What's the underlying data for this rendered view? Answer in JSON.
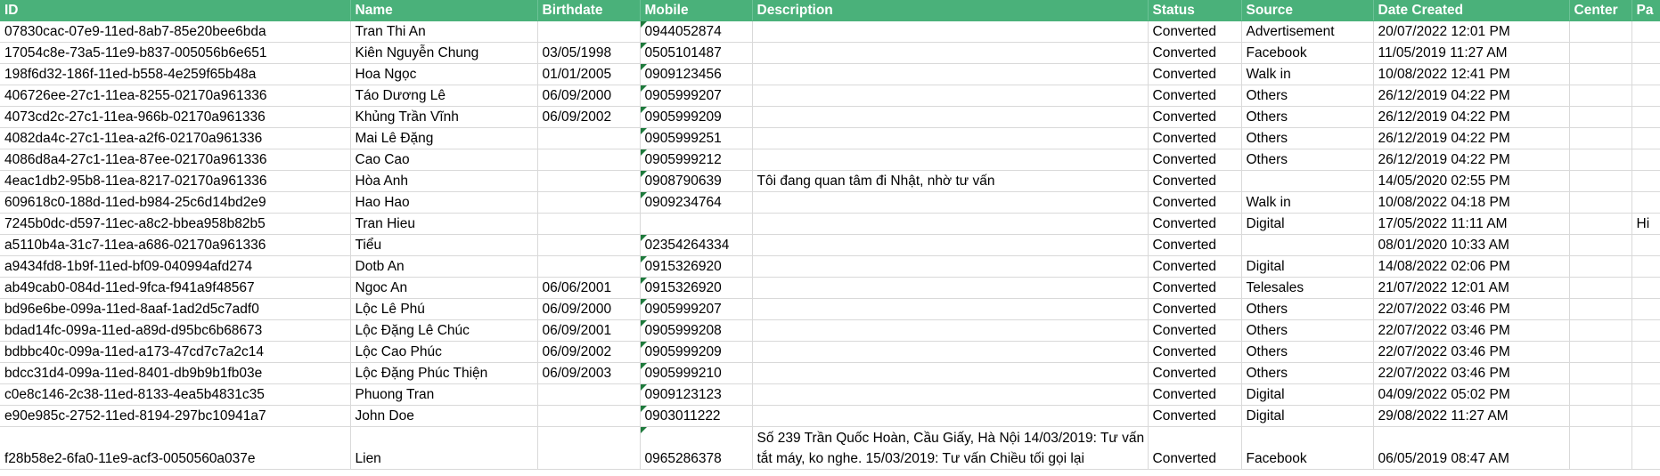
{
  "columns": [
    "ID",
    "Name",
    "Birthdate",
    "Mobile",
    "Description",
    "Status",
    "Source",
    "Date Created",
    "Center",
    "Pa"
  ],
  "rows": [
    {
      "id": "07830cac-07e9-11ed-8ab7-85e20bee6bda",
      "name": "Tran Thi An",
      "birthdate": "",
      "mobile": "0944052874",
      "description": "",
      "status": "Converted",
      "source": "Advertisement",
      "date_created": "20/07/2022 12:01  PM",
      "center": "",
      "pa": ""
    },
    {
      "id": "17054c8e-73a5-11e9-b837-005056b6e651",
      "name": "Kiên Nguyễn Chung",
      "birthdate": "03/05/1998",
      "mobile": "0505101487",
      "description": "",
      "status": "Converted",
      "source": "Facebook",
      "date_created": "11/05/2019 11:27  AM",
      "center": "",
      "pa": ""
    },
    {
      "id": "198f6d32-186f-11ed-b558-4e259f65b48a",
      "name": "Hoa Ngọc",
      "birthdate": "01/01/2005",
      "mobile": "0909123456",
      "description": "",
      "status": "Converted",
      "source": "Walk in",
      "date_created": "10/08/2022 12:41  PM",
      "center": "",
      "pa": ""
    },
    {
      "id": "406726ee-27c1-11ea-8255-02170a961336",
      "name": "Táo Dương Lê",
      "birthdate": "06/09/2000",
      "mobile": "0905999207",
      "description": "",
      "status": "Converted",
      "source": "Others",
      "date_created": "26/12/2019 04:22  PM",
      "center": "",
      "pa": ""
    },
    {
      "id": "4073cd2c-27c1-11ea-966b-02170a961336",
      "name": "Khủng Trần Vĩnh",
      "birthdate": "06/09/2002",
      "mobile": "0905999209",
      "description": "",
      "status": "Converted",
      "source": "Others",
      "date_created": "26/12/2019 04:22  PM",
      "center": "",
      "pa": ""
    },
    {
      "id": "4082da4c-27c1-11ea-a2f6-02170a961336",
      "name": "Mai Lê Đặng",
      "birthdate": "",
      "mobile": "0905999251",
      "description": "",
      "status": "Converted",
      "source": "Others",
      "date_created": "26/12/2019 04:22  PM",
      "center": "",
      "pa": ""
    },
    {
      "id": "4086d8a4-27c1-11ea-87ee-02170a961336",
      "name": "Cao Cao",
      "birthdate": "",
      "mobile": "0905999212",
      "description": "",
      "status": "Converted",
      "source": "Others",
      "date_created": "26/12/2019 04:22  PM",
      "center": "",
      "pa": ""
    },
    {
      "id": "4eac1db2-95b8-11ea-8217-02170a961336",
      "name": "Hòa Anh",
      "birthdate": "",
      "mobile": "0908790639",
      "description": "Tôi đang quan tâm đi Nhật, nhờ tư vấn",
      "status": "Converted",
      "source": "",
      "date_created": "14/05/2020 02:55  PM",
      "center": "",
      "pa": ""
    },
    {
      "id": "609618c0-188d-11ed-b984-25c6d14bd2e9",
      "name": "Hao Hao",
      "birthdate": "",
      "mobile": "0909234764",
      "description": "",
      "status": "Converted",
      "source": "Walk in",
      "date_created": "10/08/2022 04:18  PM",
      "center": "",
      "pa": ""
    },
    {
      "id": "7245b0dc-d597-11ec-a8c2-bbea958b82b5",
      "name": "Tran Hieu",
      "birthdate": "",
      "mobile": "",
      "description": "",
      "status": "Converted",
      "source": "Digital",
      "date_created": "17/05/2022 11:11  AM",
      "center": "",
      "pa": "Hi"
    },
    {
      "id": "a5110b4a-31c7-11ea-a686-02170a961336",
      "name": "Tiểu",
      "birthdate": "",
      "mobile": "02354264334",
      "description": "",
      "status": "Converted",
      "source": "",
      "date_created": "08/01/2020 10:33  AM",
      "center": "",
      "pa": ""
    },
    {
      "id": "a9434fd8-1b9f-11ed-bf09-040994afd274",
      "name": "Dotb An",
      "birthdate": "",
      "mobile": "0915326920",
      "description": "",
      "status": "Converted",
      "source": "Digital",
      "date_created": "14/08/2022 02:06  PM",
      "center": "",
      "pa": ""
    },
    {
      "id": "ab49cab0-084d-11ed-9fca-f941a9f48567",
      "name": "Ngoc An",
      "birthdate": "06/06/2001",
      "mobile": "0915326920",
      "description": "",
      "status": "Converted",
      "source": "Telesales",
      "date_created": "21/07/2022 12:01  AM",
      "center": "",
      "pa": ""
    },
    {
      "id": "bd96e6be-099a-11ed-8aaf-1ad2d5c7adf0",
      "name": "Lộc Lê Phú",
      "birthdate": "06/09/2000",
      "mobile": "0905999207",
      "description": "",
      "status": "Converted",
      "source": "Others",
      "date_created": "22/07/2022 03:46  PM",
      "center": "",
      "pa": ""
    },
    {
      "id": "bdad14fc-099a-11ed-a89d-d95bc6b68673",
      "name": "Lộc Đặng Lê Chúc",
      "birthdate": "06/09/2001",
      "mobile": "0905999208",
      "description": "",
      "status": "Converted",
      "source": "Others",
      "date_created": "22/07/2022 03:46  PM",
      "center": "",
      "pa": ""
    },
    {
      "id": "bdbbc40c-099a-11ed-a173-47cd7c7a2c14",
      "name": "Lộc Cao Phúc",
      "birthdate": "06/09/2002",
      "mobile": "0905999209",
      "description": "",
      "status": "Converted",
      "source": "Others",
      "date_created": "22/07/2022 03:46  PM",
      "center": "",
      "pa": ""
    },
    {
      "id": "bdcc31d4-099a-11ed-8401-db9b9b1fb03e",
      "name": "Lộc Đặng Phúc Thiện",
      "birthdate": "06/09/2003",
      "mobile": "0905999210",
      "description": "",
      "status": "Converted",
      "source": "Others",
      "date_created": "22/07/2022 03:46  PM",
      "center": "",
      "pa": ""
    },
    {
      "id": "c0e8c146-2c38-11ed-8133-4ea5b4831c35",
      "name": "Phuong Tran",
      "birthdate": "",
      "mobile": "0909123123",
      "description": "",
      "status": "Converted",
      "source": "Digital",
      "date_created": "04/09/2022 05:02  PM",
      "center": "",
      "pa": ""
    },
    {
      "id": "e90e985c-2752-11ed-8194-297bc10941a7",
      "name": "John Doe",
      "birthdate": "",
      "mobile": "0903011222",
      "description": "",
      "status": "Converted",
      "source": "Digital",
      "date_created": "29/08/2022 11:27  AM",
      "center": "",
      "pa": ""
    },
    {
      "id": "f28b58e2-6fa0-11e9-acf3-0050560a037e",
      "name": "Lien",
      "birthdate": "",
      "mobile": "0965286378",
      "description": "Số 239 Trần Quốc Hoàn, Cầu Giấy, Hà Nội 14/03/2019: Tư vấn tắt máy, ko nghe. 15/03/2019: Tư vấn Chiều tối gọi lại",
      "status": "Converted",
      "source": "Facebook",
      "date_created": "06/05/2019 08:47  AM",
      "center": "",
      "pa": ""
    }
  ],
  "colors": {
    "header_bg": "#4ab17a",
    "header_text": "#ffffff",
    "gridline": "#d9d9d9",
    "comment_marker": "#1e7a3c"
  }
}
